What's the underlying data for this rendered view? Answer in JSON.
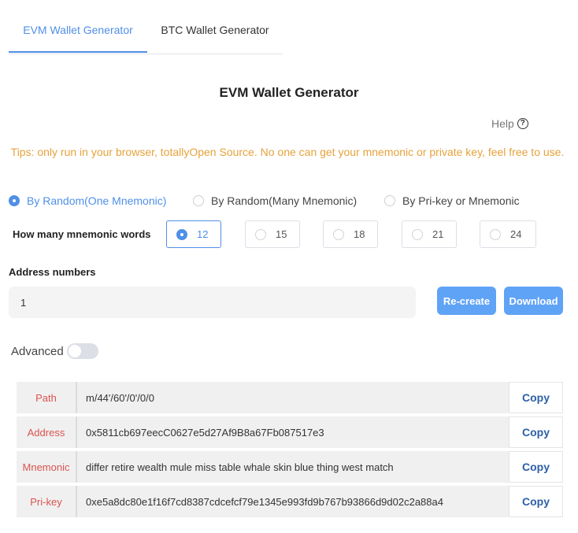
{
  "tabs": [
    {
      "label": "EVM Wallet Generator",
      "active": true
    },
    {
      "label": "BTC Wallet Generator",
      "active": false
    }
  ],
  "page_title": "EVM Wallet Generator",
  "help_label": "Help",
  "help_icon": "question-circle-icon",
  "tips": "Tips: only run in your browser, totallyOpen Source. No one can get your mnemonic or private key, feel free to use.",
  "colors": {
    "accent": "#4f8fe8",
    "button": "#5fa3f7",
    "tips": "#e6a23c",
    "key_label": "#d9534f",
    "copy": "#2c5fa6"
  },
  "modes": [
    {
      "label": "By Random(One Mnemonic)",
      "checked": true
    },
    {
      "label": "By Random(Many Mnemonic)",
      "checked": false
    },
    {
      "label": "By Pri-key or Mnemonic",
      "checked": false
    }
  ],
  "words_label": "How many mnemonic words",
  "word_options": [
    {
      "label": "12",
      "checked": true
    },
    {
      "label": "15",
      "checked": false
    },
    {
      "label": "18",
      "checked": false
    },
    {
      "label": "21",
      "checked": false
    },
    {
      "label": "24",
      "checked": false
    }
  ],
  "address_label": "Address numbers",
  "address_value": "1",
  "buttons": {
    "recreate": "Re-create",
    "download": "Download"
  },
  "advanced": {
    "label": "Advanced",
    "enabled": false
  },
  "results": [
    {
      "key": "Path",
      "value": "m/44'/60'/0'/0/0",
      "copy": "Copy"
    },
    {
      "key": "Address",
      "value": "0x5811cb697eecC0627e5d27Af9B8a67Fb087517e3",
      "copy": "Copy"
    },
    {
      "key": "Mnemonic",
      "value": "differ retire wealth mule miss table whale skin blue thing west match",
      "copy": "Copy"
    },
    {
      "key": "Pri-key",
      "value": "0xe5a8dc80e1f16f7cd8387cdcefcf79e1345e993fd9b767b93866d9d02c2a88a4",
      "copy": "Copy"
    }
  ]
}
